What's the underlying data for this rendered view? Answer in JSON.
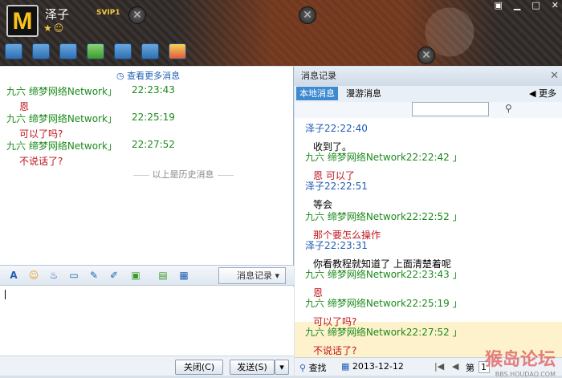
{
  "header": {
    "logo": "M",
    "name": "泽子",
    "vip": "SVIP1",
    "stars": "★☺"
  },
  "window_controls": {
    "restore": "▣",
    "min": "▁",
    "max": "□",
    "close": "✕"
  },
  "left": {
    "more_link": "查看更多消息",
    "messages": [
      {
        "who": "九六  缔梦网络Network」",
        "time": "22:23:43",
        "text": "恩"
      },
      {
        "who": "九六  缔梦网络Network」",
        "time": "22:25:19",
        "text": "可以了吗?"
      },
      {
        "who": "九六  缔梦网络Network」",
        "time": "22:27:52",
        "text": "不说话了?"
      }
    ],
    "history_divider": "以上是历史消息",
    "history_button": "消息记录",
    "close_button": "关闭(C)",
    "send_button": "发送(S)"
  },
  "right": {
    "title": "消息记录",
    "tab_local": "本地消息",
    "tab_roam": "漫游消息",
    "more": "更多",
    "messages": [
      {
        "hd": "泽子22:22:40",
        "text": "收到了。",
        "hdcolor": "#1f5eb1",
        "txcolor": "#000000"
      },
      {
        "hd": "九六  缔梦网络Network22:22:42  」",
        "text": "恩  可以了",
        "hdcolor": "#1c8a1c",
        "txcolor": "#c0141c"
      },
      {
        "hd": "泽子22:22:51",
        "text": "等会",
        "hdcolor": "#1f5eb1",
        "txcolor": "#000000"
      },
      {
        "hd": "九六  缔梦网络Network22:22:52  」",
        "text": "那个要怎么操作",
        "hdcolor": "#1c8a1c",
        "txcolor": "#c0141c"
      },
      {
        "hd": "泽子22:23:31",
        "text": "你看教程就知道了  上面清楚着呢",
        "hdcolor": "#1f5eb1",
        "txcolor": "#000000"
      },
      {
        "hd": "九六  缔梦网络Network22:23:43  」",
        "text": "恩",
        "hdcolor": "#1c8a1c",
        "txcolor": "#c0141c"
      },
      {
        "hd": "九六  缔梦网络Network22:25:19  」",
        "text": "可以了吗?",
        "hdcolor": "#1c8a1c",
        "txcolor": "#c0141c"
      },
      {
        "hd": "九六  缔梦网络Network22:27:52  」",
        "text": "不说话了?",
        "hdcolor": "#1c8a1c",
        "txcolor": "#c0141c"
      }
    ],
    "search": "查找",
    "date": "2013-12-12",
    "page_label": "第",
    "page_num": "1",
    "watermark": "猴岛论坛",
    "watermark_url": "BBS.HOUDAO.COM"
  }
}
